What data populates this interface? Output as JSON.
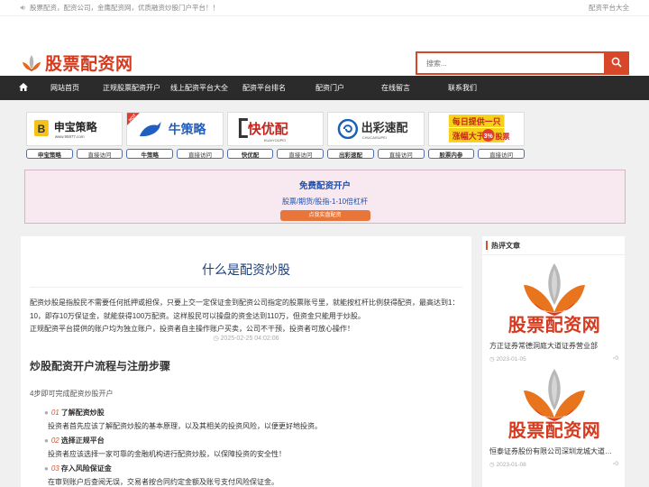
{
  "topbar": {
    "notice": "股票配资，配资公司，金鹰配资网，优质融资炒股门户平台！！",
    "right_link": "配资平台大全"
  },
  "header": {
    "logo_text": "股票配资网",
    "search_placeholder": "搜索..."
  },
  "nav": {
    "items": [
      "网站首页",
      "正规股票配资开户",
      "线上配资平台大全",
      "配资平台排名",
      "配资门户",
      "在线留言",
      "联系我们"
    ]
  },
  "ads": [
    {
      "logo": "申宝策略",
      "sub": "www.95977.com",
      "name": "申宝策略",
      "visit": "直接访问"
    },
    {
      "logo": "牛策略",
      "sub": "HOT",
      "name": "牛策略",
      "visit": "直接访问"
    },
    {
      "logo": "快优配",
      "sub": "KUAIYOUPEI",
      "name": "快优配",
      "visit": "直接访问"
    },
    {
      "logo": "出彩速配",
      "sub": "CHUCAISUPEI",
      "name": "出彩速配",
      "visit": "直接访问"
    },
    {
      "logo1": "每日提供一只",
      "logo2": "涨幅大于",
      "logo3": "3%",
      "logo4": "股票",
      "name": "股票内参",
      "visit": "直接访问"
    }
  ],
  "promo": {
    "title": "免费配资开户",
    "subtitle": "股票/期货/股指-1-10倍杠杆",
    "button": "点我实盘配资"
  },
  "article": {
    "title": "什么是配资炒股",
    "para1": "配资炒股是指股民不需要任何抵押或担保，只要上交一定保证金到配资公司指定的股票账号里，就能按杠杆比例获得配资，最高达到1：10，即存10万保证金，就能获得100万配资。这样股民可以操盘的资金达到110万，但资金只能用于炒股。",
    "para2": "正规配资平台提供的账户均为独立账户，投资者自主操作账户买卖，公司不干预，投资者可放心操作！",
    "meta": "2025-02-25 04:02:06",
    "h2": "炒股配资开户流程与注册步骤",
    "intro": "4步即可完成配资炒股开户",
    "steps": [
      {
        "num": "01",
        "label": "了解配资炒股",
        "desc": "投资者首先应该了解配资炒股的基本原理，以及其相关的投资风险，以便更好地投资。"
      },
      {
        "num": "02",
        "label": "选择正规平台",
        "desc": "投资者应该选择一家可靠的金融机构进行配资炒股，以保障投资的安全性！"
      },
      {
        "num": "03",
        "label": "存入风险保证金",
        "desc": "在审到账户后查阅无误，交易者按合同约定金额及账号支付风险保证金。"
      }
    ]
  },
  "sidebar": {
    "title": "热评文章",
    "items": [
      {
        "thumb_text": "股票配资网",
        "title": "方正证券常德洞庭大道证券营业部",
        "date": "2023-01-05",
        "comments": "0"
      },
      {
        "thumb_text": "股票配资网",
        "title": "恒泰证券股份有限公司深圳龙城大道证券营业部",
        "date": "2023-01-08",
        "comments": "0"
      }
    ]
  },
  "colors": {
    "brand_red": "#d63a1e",
    "nav_bg": "#2b2b2b",
    "link_blue": "#1a4fb0",
    "accent_orange": "#e8763a"
  }
}
